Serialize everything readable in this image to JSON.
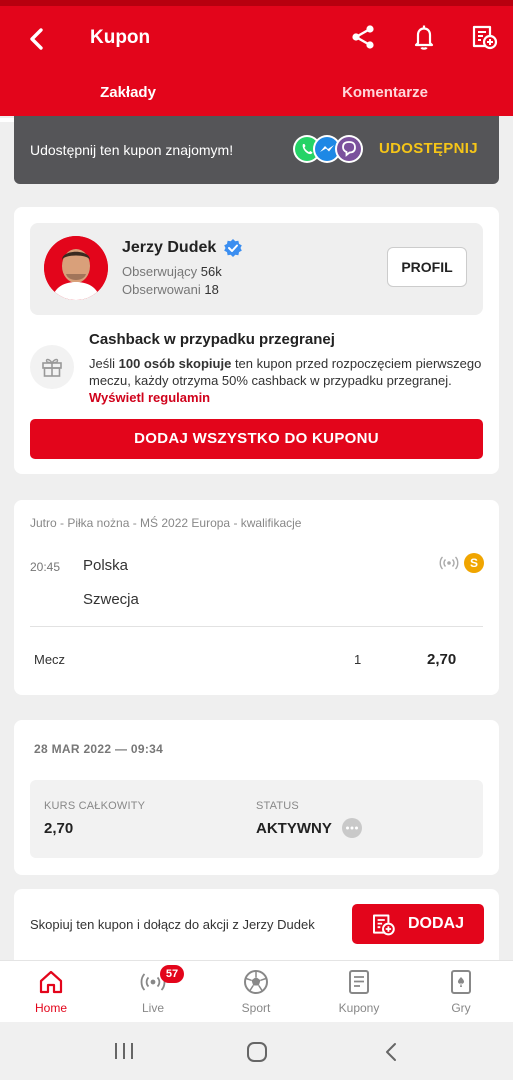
{
  "header": {
    "title": "Kupon",
    "back_icon": "chevron-left-icon",
    "icons": [
      "share-icon",
      "bell-icon",
      "coupon-add-icon"
    ]
  },
  "tabs": [
    {
      "label": "Zakłady",
      "active": true
    },
    {
      "label": "Komentarze",
      "active": false
    }
  ],
  "share_banner": {
    "text": "Udostępnij ten kupon znajomym!",
    "apps": [
      "whatsapp-icon",
      "messenger-icon",
      "viber-icon"
    ],
    "button": "UDOSTĘPNIJ"
  },
  "tipster": {
    "name": "Jerzy Dudek",
    "followers_label": "Obserwujący",
    "followers": "56k",
    "following_label": "Obserwowani",
    "following": "18",
    "profile_button": "PROFIL"
  },
  "cashback": {
    "title": "Cashback w przypadku przegranej",
    "text_a": "Jeśli ",
    "text_bold": "100 osób skopiuje",
    "text_b": " ten kupon przed rozpoczęciem pierwszego meczu, każdy otrzyma 50% cashback w przypadku przegranej. ",
    "link": "Wyświetl regulamin"
  },
  "add_all_button": "DODAJ WSZYSTKO DO KUPONU",
  "match": {
    "meta": "Jutro - Piłka nożna - MŚ 2022 Europa - kwalifikacje",
    "time": "20:45",
    "home": "Polska",
    "away": "Szwecja",
    "badge": "S",
    "market": "Mecz",
    "selection": "1",
    "odds": "2,70"
  },
  "summary": {
    "date": "28 MAR 2022 — 09:34",
    "total_label": "KURS CAŁKOWITY",
    "total": "2,70",
    "status_label": "STATUS",
    "status": "AKTYWNY"
  },
  "copy_bar": {
    "text": "Skopiuj ten kupon i dołącz do akcji z Jerzy Dudek",
    "button": "DODAJ"
  },
  "bottom_nav": [
    {
      "label": "Home",
      "icon": "home-icon",
      "active": true
    },
    {
      "label": "Live",
      "icon": "live-icon",
      "badge": "57"
    },
    {
      "label": "Sport",
      "icon": "soccer-ball-icon"
    },
    {
      "label": "Kupony",
      "icon": "coupon-icon"
    },
    {
      "label": "Gry",
      "icon": "cards-icon"
    }
  ],
  "colors": {
    "brand_red": "#e3051b",
    "share_yellow": "#f5c518",
    "banner_gray": "#555558"
  }
}
